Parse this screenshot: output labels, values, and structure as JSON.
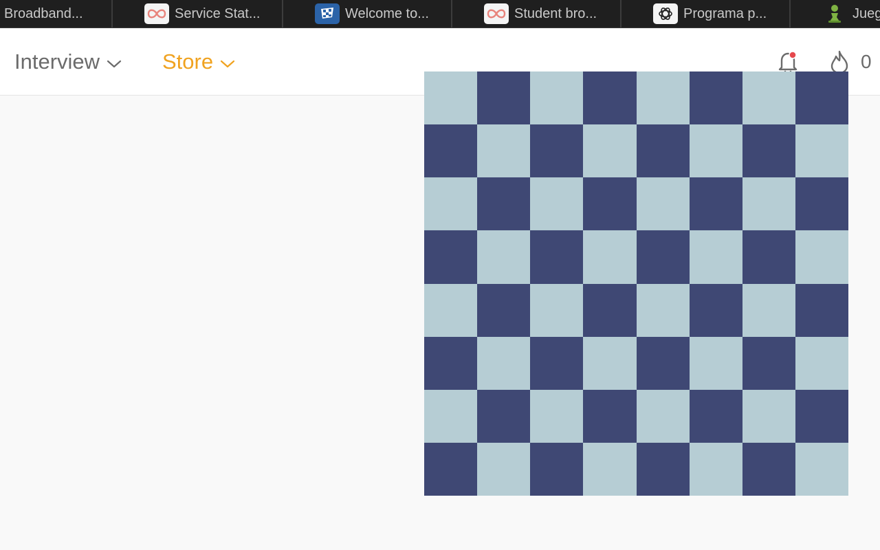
{
  "browser": {
    "tabs": [
      {
        "label": "Broadband...",
        "icon": "none"
      },
      {
        "label": "Service Stat...",
        "icon": "infinity-icon"
      },
      {
        "label": "Welcome to...",
        "icon": "checkered-flag-icon"
      },
      {
        "label": "Student bro...",
        "icon": "infinity-icon"
      },
      {
        "label": "Programa p...",
        "icon": "openai-icon"
      },
      {
        "label": "Jueg",
        "icon": "chess-pawn-icon"
      }
    ]
  },
  "header": {
    "nav": [
      {
        "label": "Interview",
        "color": "#6b6b6b"
      },
      {
        "label": "Store",
        "color": "#f0a21f"
      }
    ],
    "notifications": {
      "icon": "bell-icon",
      "has_unread": true,
      "dot_color": "#e5484d"
    },
    "streak": {
      "icon": "flame-icon",
      "count": "0"
    }
  },
  "board": {
    "size": 8,
    "light_color": "#b6cdd4",
    "dark_color": "#3f4874",
    "top_left": "light"
  }
}
